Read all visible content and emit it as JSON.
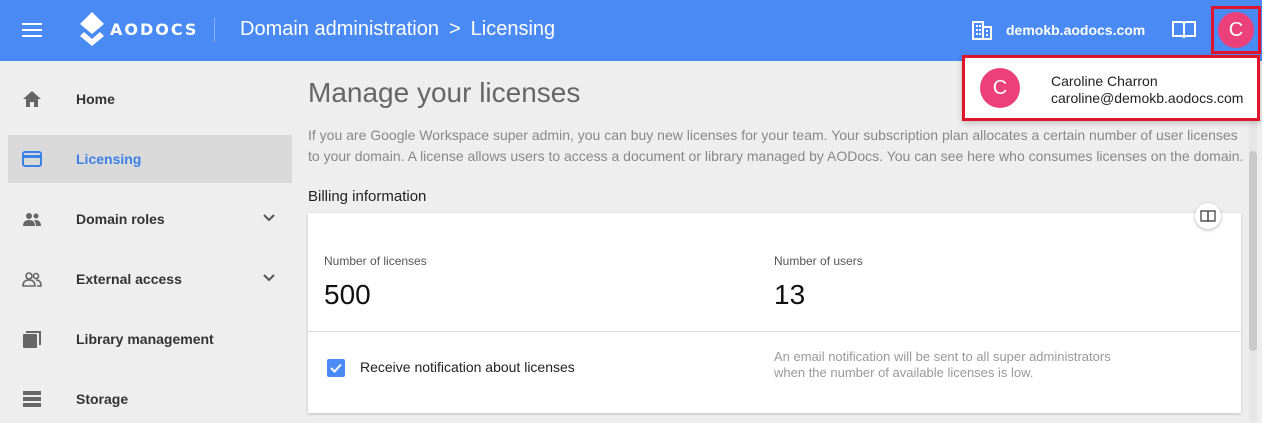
{
  "topbar": {
    "logo_text": "AODOCS",
    "breadcrumb": {
      "parent": "Domain administration",
      "separator": ">",
      "current": "Licensing"
    },
    "domain": "demokb.aodocs.com",
    "avatar_initial": "C"
  },
  "sidebar": {
    "items": [
      {
        "label": "Home",
        "icon": "home-icon"
      },
      {
        "label": "Licensing",
        "icon": "credit-card-icon",
        "active": true
      },
      {
        "label": "Domain roles",
        "icon": "people-icon",
        "expandable": true
      },
      {
        "label": "External access",
        "icon": "people-outline-icon",
        "expandable": true
      },
      {
        "label": "Library management",
        "icon": "library-icon"
      },
      {
        "label": "Storage",
        "icon": "storage-icon"
      }
    ]
  },
  "main": {
    "title": "Manage your licenses",
    "description": "If you are Google Workspace super admin, you can buy new licenses for your team. Your subscription plan allocates a certain number of user licenses to your domain. A license allows users to access a document or library managed by AODocs. You can see here who consumes licenses on the domain.",
    "billing": {
      "section_title": "Billing information",
      "licenses_label": "Number of licenses",
      "licenses_value": "500",
      "users_label": "Number of users",
      "users_value": "13",
      "notify_label": "Receive notification about licenses",
      "notify_checked": true,
      "notify_help": "An email notification will be sent to all super administrators when the number of available licenses is low."
    }
  },
  "user_popup": {
    "initial": "C",
    "name": "Caroline Charron",
    "email": "caroline@demokb.aodocs.com"
  },
  "colors": {
    "topbar": "#4a8af4",
    "avatar": "#ec407a",
    "highlight_border": "#e0142a",
    "active_nav_text": "#3b7fe8"
  }
}
